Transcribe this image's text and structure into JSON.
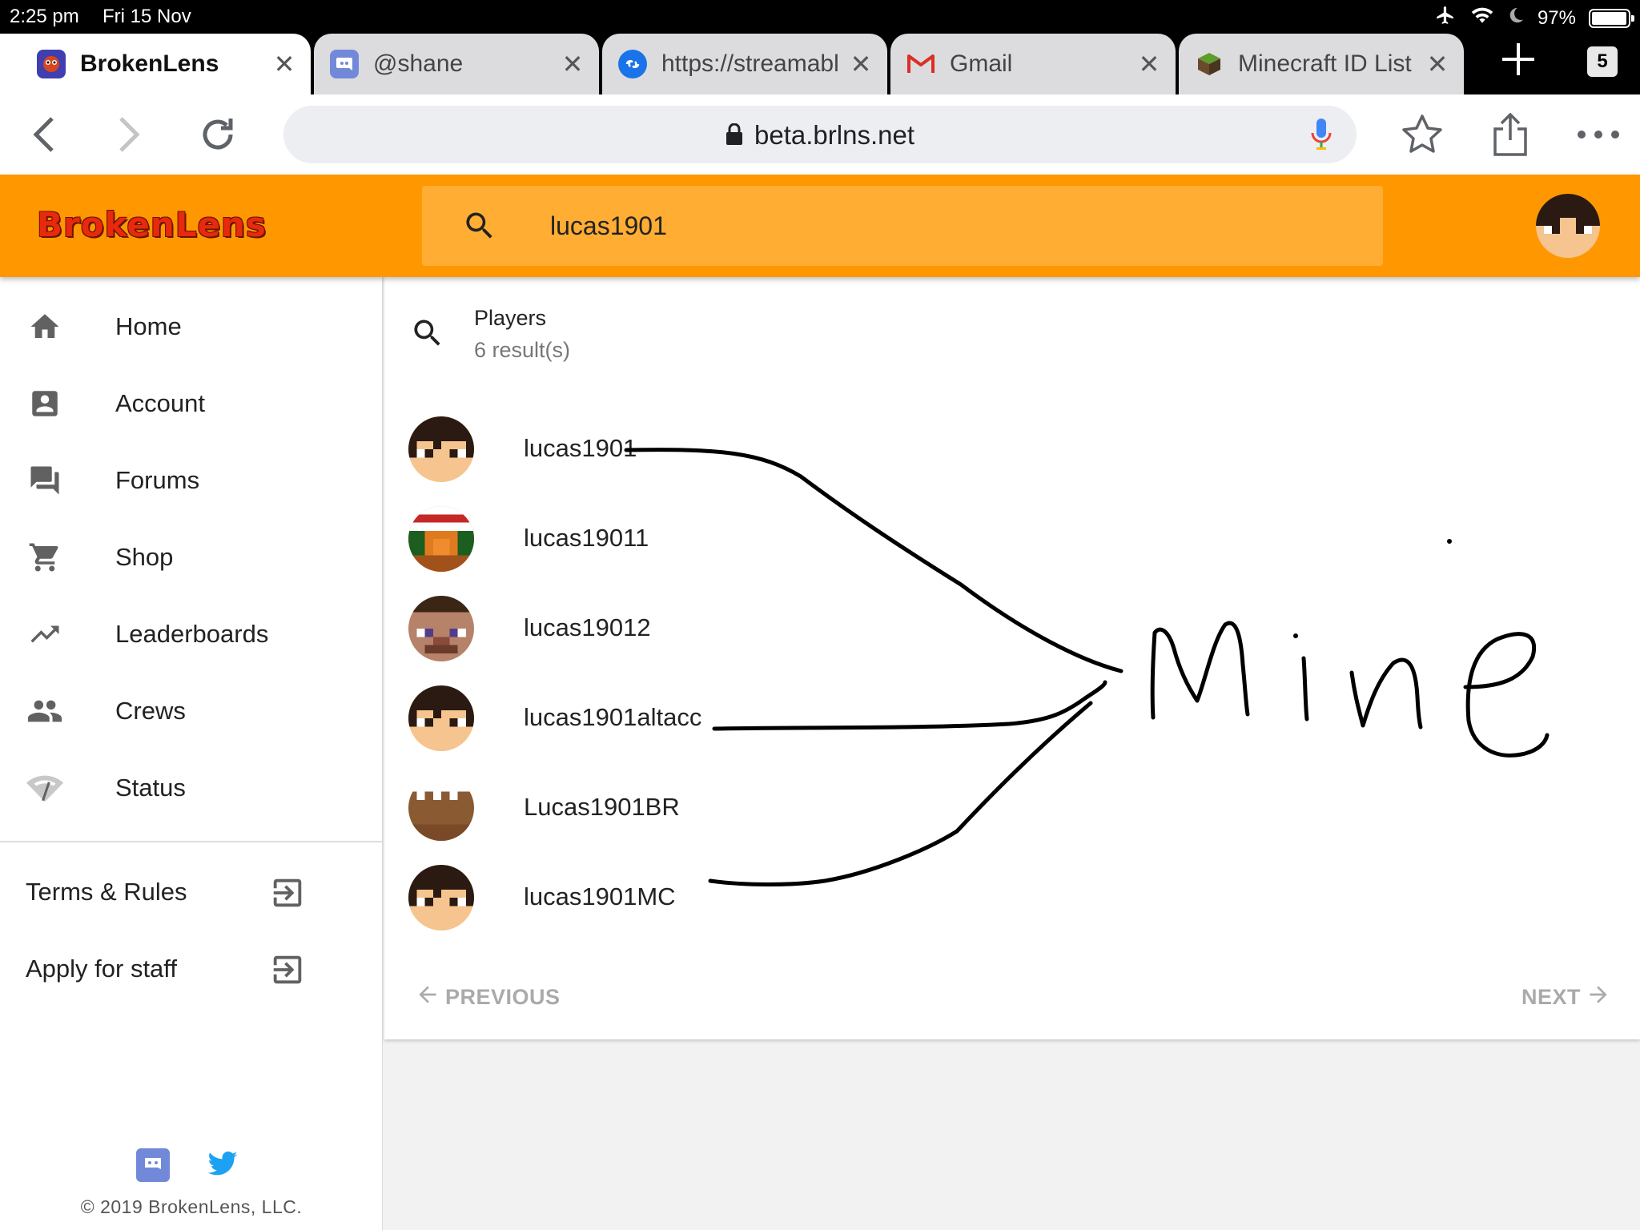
{
  "statusbar": {
    "time": "2:25 pm",
    "date": "Fri 15 Nov",
    "battery": "97%",
    "battery_level": 0.97
  },
  "tabs": [
    {
      "title": "BrokenLens",
      "icon": "brokenlens-favicon",
      "active": true
    },
    {
      "title": "@shane",
      "icon": "discord-favicon",
      "active": false
    },
    {
      "title": "https://streamabl",
      "icon": "streamable-favicon",
      "active": false
    },
    {
      "title": "Gmail",
      "icon": "gmail-favicon",
      "active": false
    },
    {
      "title": "Minecraft ID List",
      "icon": "minecraft-favicon",
      "active": false
    }
  ],
  "tab_count": "5",
  "toolbar": {
    "url": "beta.brlns.net"
  },
  "site": {
    "logo": "BrokenLens",
    "search_value": "lucas1901",
    "colors": {
      "header": "#ff9800",
      "search": "#ffad33"
    }
  },
  "sidebar": {
    "nav": [
      {
        "label": "Home",
        "icon": "home-icon"
      },
      {
        "label": "Account",
        "icon": "account-icon"
      },
      {
        "label": "Forums",
        "icon": "forum-icon"
      },
      {
        "label": "Shop",
        "icon": "cart-icon"
      },
      {
        "label": "Leaderboards",
        "icon": "trending-up-icon"
      },
      {
        "label": "Crews",
        "icon": "people-icon"
      },
      {
        "label": "Status",
        "icon": "signal-icon"
      }
    ],
    "external": [
      {
        "label": "Terms & Rules",
        "icon": "exit-to-app-icon"
      },
      {
        "label": "Apply for staff",
        "icon": "exit-to-app-icon"
      }
    ],
    "copyright": "© 2019 BrokenLens, LLC."
  },
  "results": {
    "title": "Players",
    "count_text": "6 result(s)",
    "players": [
      {
        "name": "lucas1901",
        "avatar": "dark-hair-skin"
      },
      {
        "name": "lucas19011",
        "avatar": "santa-hat-skin"
      },
      {
        "name": "lucas19012",
        "avatar": "steve-skin"
      },
      {
        "name": "lucas1901altacc",
        "avatar": "dark-hair-skin"
      },
      {
        "name": "Lucas1901BR",
        "avatar": "brown-skin"
      },
      {
        "name": "lucas1901MC",
        "avatar": "dark-hair-skin"
      }
    ],
    "prev_label": "PREVIOUS",
    "next_label": "NEXT"
  },
  "annotation": {
    "text": "Mine"
  }
}
